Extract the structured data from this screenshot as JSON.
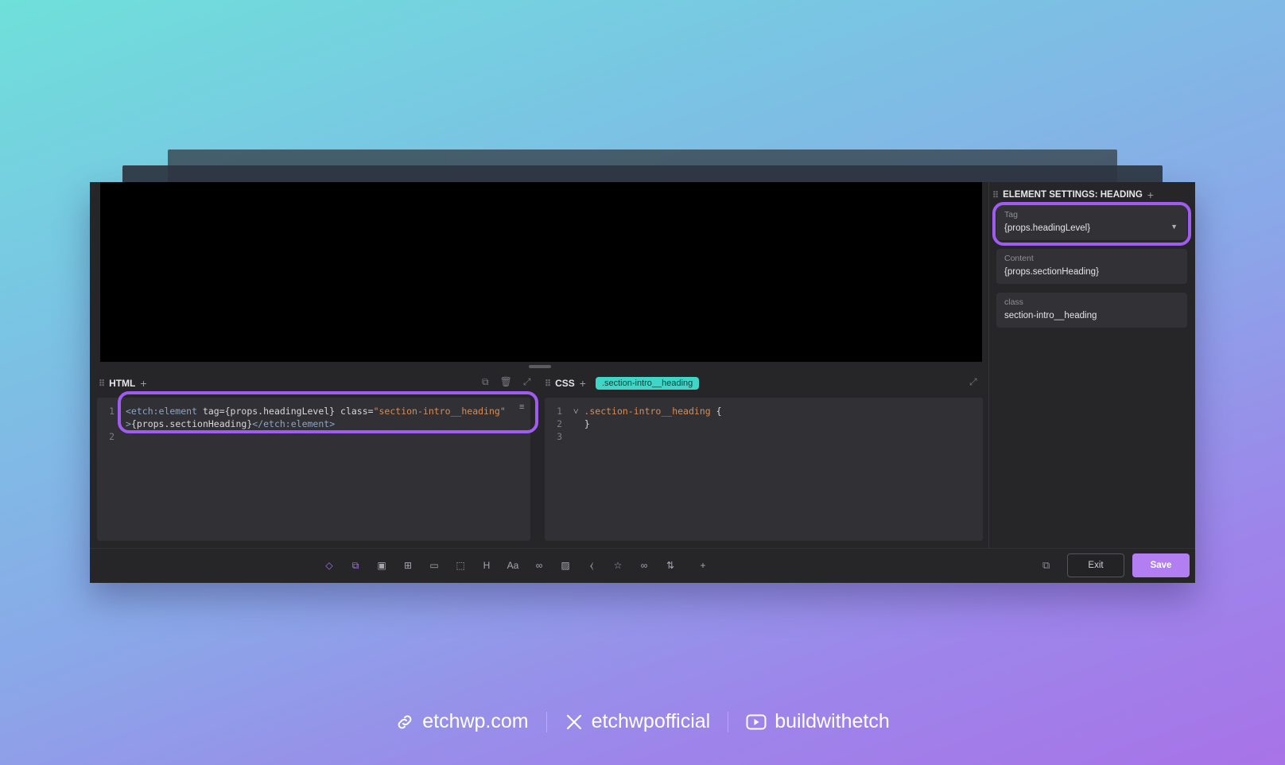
{
  "html_panel": {
    "title": "HTML",
    "lines": [
      {
        "num": "1",
        "parts": [
          {
            "t": "<etch:element",
            "c": "tag"
          },
          {
            "t": " tag={props.headingLevel} class=",
            "c": "plain"
          },
          {
            "t": "\"section-intro__heading\"",
            "c": "str"
          }
        ]
      },
      {
        "num": "",
        "parts": [
          {
            "t": ">",
            "c": "tag"
          },
          {
            "t": "{props.sectionHeading}",
            "c": "plain"
          },
          {
            "t": "</etch:element>",
            "c": "tag"
          }
        ]
      },
      {
        "num": "2",
        "parts": []
      }
    ]
  },
  "css_panel": {
    "title": "CSS",
    "chip": ".section-intro__heading",
    "lines": [
      {
        "num": "1",
        "parts": [
          {
            "t": "˅ ",
            "c": "plain"
          },
          {
            "t": ".section-intro__heading",
            "c": "sel"
          },
          {
            "t": " {",
            "c": "plain"
          }
        ]
      },
      {
        "num": "2",
        "parts": [
          {
            "t": "  }",
            "c": "plain"
          }
        ]
      },
      {
        "num": "3",
        "parts": []
      }
    ]
  },
  "settings": {
    "title": "ELEMENT SETTINGS: HEADING",
    "tag": {
      "label": "Tag",
      "value": "{props.headingLevel}"
    },
    "content": {
      "label": "Content",
      "value": "{props.sectionHeading}"
    },
    "class": {
      "label": "class",
      "value": "section-intro__heading"
    }
  },
  "toolbar": {
    "tools": [
      "diamond-icon",
      "components-icon",
      "section-icon",
      "grid-icon",
      "container-icon",
      "div-icon",
      "heading-icon",
      "text-icon",
      "link-icon",
      "image-icon",
      "code-icon",
      "star-icon",
      "loop-icon",
      "sort-icon",
      "add-icon"
    ],
    "tool_glyphs": [
      "◇",
      "⧉",
      "▣",
      "⊞",
      "▭",
      "⬚",
      "H",
      "Aa",
      "∞",
      "▨",
      "⧼",
      "☆",
      "∞",
      "⇅",
      "+"
    ],
    "exit_label": "Exit",
    "save_label": "Save"
  },
  "footer": {
    "website": "etchwp.com",
    "x_handle": "etchwpofficial",
    "youtube": "buildwithetch"
  },
  "colors": {
    "accent_purple": "#a05cf0",
    "save_button": "#b27ef2",
    "chip_teal": "#3fd6c8"
  }
}
